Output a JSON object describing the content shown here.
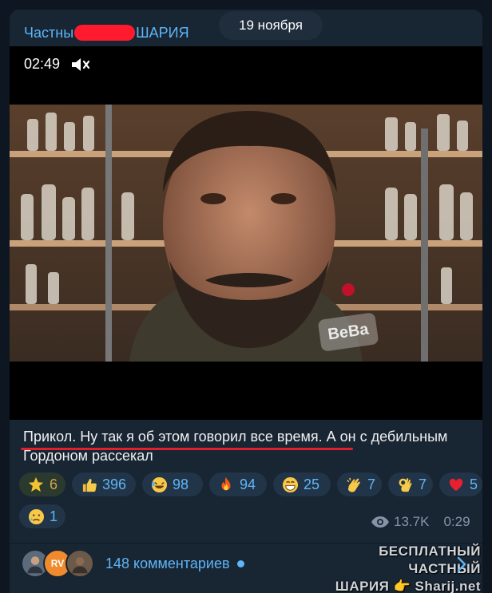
{
  "channel": {
    "name_start": "Частны",
    "name_end": "ШАРИЯ"
  },
  "date_pill": "19 ноября",
  "video": {
    "time": "02:49",
    "watermark": "BeBa"
  },
  "caption": "Прикол. Ну так я об этом говорил все время. А он с дебильным Гордоном рассекал",
  "reactions": [
    {
      "emoji": "star-icon",
      "count": "6",
      "own": true
    },
    {
      "emoji": "thumbs-up-icon",
      "count": "396"
    },
    {
      "emoji": "rofl-icon",
      "count": "98"
    },
    {
      "emoji": "fire-icon",
      "count": "94"
    },
    {
      "emoji": "grin-icon",
      "count": "25"
    },
    {
      "emoji": "clap-icon",
      "count": "7"
    },
    {
      "emoji": "ok-hand-icon",
      "count": "7"
    },
    {
      "emoji": "heart-icon",
      "count": "5"
    },
    {
      "emoji": "sad-tear-icon",
      "count": "1"
    }
  ],
  "meta": {
    "views": "13.7K",
    "duration": "0:29"
  },
  "comments": {
    "label": "148 комментариев",
    "avatar_initials": "RV"
  },
  "brand": {
    "line1": "БЕСПЛАТНЫЙ ЧАСТНЫЙ",
    "line2_a": "ШАРИЯ",
    "line2_b": "Sharij.net"
  },
  "colors": {
    "accent": "#5eb5f7",
    "bubble": "#182533",
    "background": "#0e1621",
    "redaction": "#ff1b2d",
    "underline": "#e0202a"
  }
}
